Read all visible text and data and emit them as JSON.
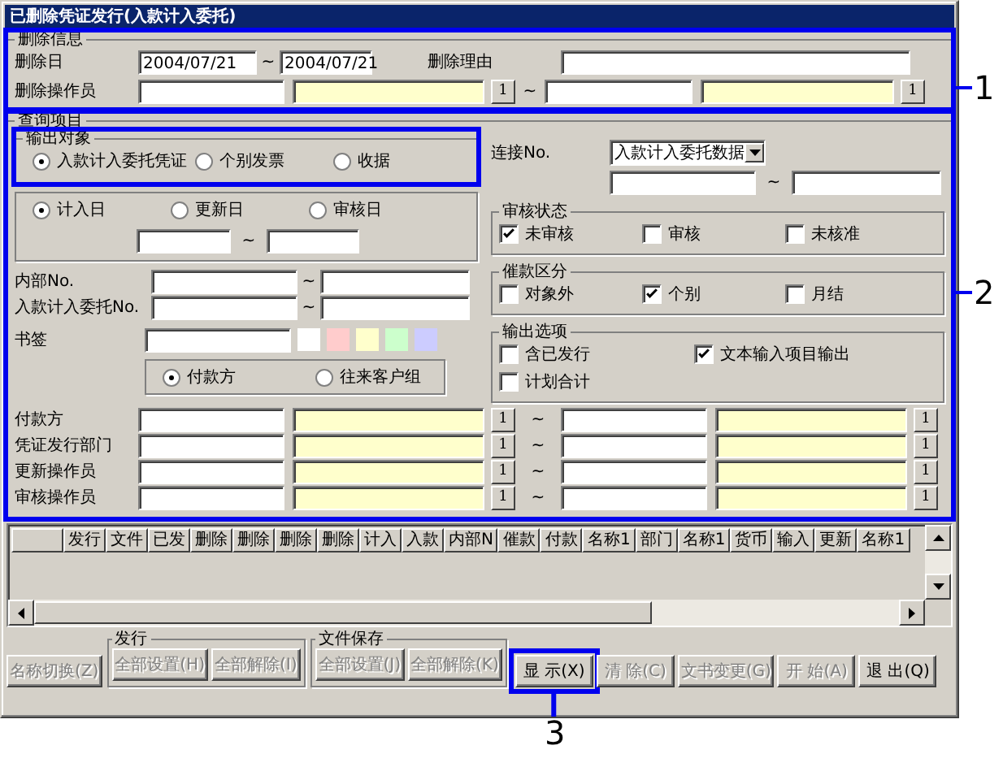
{
  "window": {
    "title": "已删除凭证发行(入款计入委托)"
  },
  "delete_info": {
    "title": "删除信息",
    "callout": "1",
    "date": {
      "label": "删除日",
      "from": "2004/07/21",
      "separator": "~",
      "to": "2004/07/21"
    },
    "reason": {
      "label": "删除理由"
    },
    "operator": {
      "label": "删除操作员",
      "buttons": [
        "1",
        "1"
      ],
      "separator": "~"
    }
  },
  "query": {
    "title": "查询项目",
    "callout": "2",
    "output_target": {
      "title": "输出对象",
      "highlighted": true,
      "options": [
        {
          "label": "入款计入委托凭证",
          "selected": true
        },
        {
          "label": "个别发票",
          "selected": false
        },
        {
          "label": "收据",
          "selected": false
        }
      ]
    },
    "date_type": {
      "separator": "~",
      "options": [
        {
          "label": "计入日",
          "selected": true
        },
        {
          "label": "更新日",
          "selected": false
        },
        {
          "label": "审核日",
          "selected": false
        }
      ]
    },
    "number_ranges": [
      {
        "label": "内部No.",
        "separator": "~"
      },
      {
        "label": "入款计入委托No.",
        "separator": "~"
      }
    ],
    "bookmark": {
      "label": "书签",
      "swatches": [
        {
          "color": "#ffffff"
        },
        {
          "color": "#ffcccc"
        },
        {
          "color": "#ffffcc"
        },
        {
          "color": "#ccffcc"
        },
        {
          "color": "#ccccff"
        }
      ]
    },
    "payer_type": {
      "options": [
        {
          "label": "付款方",
          "selected": true
        },
        {
          "label": "往来客户组",
          "selected": false
        }
      ]
    },
    "link": {
      "label": "连接No.",
      "dropdown": "入款计入委托数据",
      "separator": "~"
    },
    "review_status": {
      "title": "审核状态",
      "options": [
        {
          "label": "未审核",
          "checked": true
        },
        {
          "label": "审核",
          "checked": false
        },
        {
          "label": "未核准",
          "checked": false
        }
      ]
    },
    "dunning": {
      "title": "催款区分",
      "options": [
        {
          "label": "对象外",
          "checked": false
        },
        {
          "label": "个别",
          "checked": true
        },
        {
          "label": "月结",
          "checked": false
        }
      ]
    },
    "output_options": {
      "title": "输出选项",
      "options": [
        {
          "label": "含已发行",
          "checked": false
        },
        {
          "label": "文本输入项目输出",
          "checked": true
        },
        {
          "label": "计划合计",
          "checked": false
        }
      ]
    },
    "lookup_rows": [
      {
        "label": "付款方",
        "buttons": [
          "1",
          "1"
        ],
        "separator": "~"
      },
      {
        "label": "凭证发行部门",
        "buttons": [
          "1",
          "1"
        ],
        "separator": "~"
      },
      {
        "label": "更新操作员",
        "buttons": [
          "1",
          "1"
        ],
        "separator": "~"
      },
      {
        "label": "审核操作员",
        "buttons": [
          "1",
          "1"
        ],
        "separator": "~"
      }
    ]
  },
  "table": {
    "columns": [
      "发行",
      "文件",
      "已发",
      "删除",
      "删除",
      "删除",
      "删除",
      "计入",
      "入款",
      "内部N",
      "催款",
      "付款",
      "名称1",
      "部门",
      "名称1",
      "货币",
      "输入",
      "更新",
      "名称1"
    ]
  },
  "bottom": {
    "name_toggle": {
      "label": "名称切换(Z)",
      "disabled": true
    },
    "groups": [
      {
        "title": "发行",
        "buttons": [
          {
            "label": "全部设置(H)",
            "disabled": true
          },
          {
            "label": "全部解除(I)",
            "disabled": true
          }
        ]
      },
      {
        "title": "文件保存",
        "buttons": [
          {
            "label": "全部设置(J)",
            "disabled": true
          },
          {
            "label": "全部解除(K)",
            "disabled": true
          }
        ]
      }
    ],
    "actions": [
      {
        "label": "显 示(X)",
        "disabled": false,
        "callout": "3"
      },
      {
        "label": "清 除(C)",
        "disabled": true
      },
      {
        "label": "文书变更(G)",
        "disabled": true
      },
      {
        "label": "开 始(A)",
        "disabled": true
      },
      {
        "label": "退 出(Q)",
        "disabled": false
      }
    ]
  }
}
